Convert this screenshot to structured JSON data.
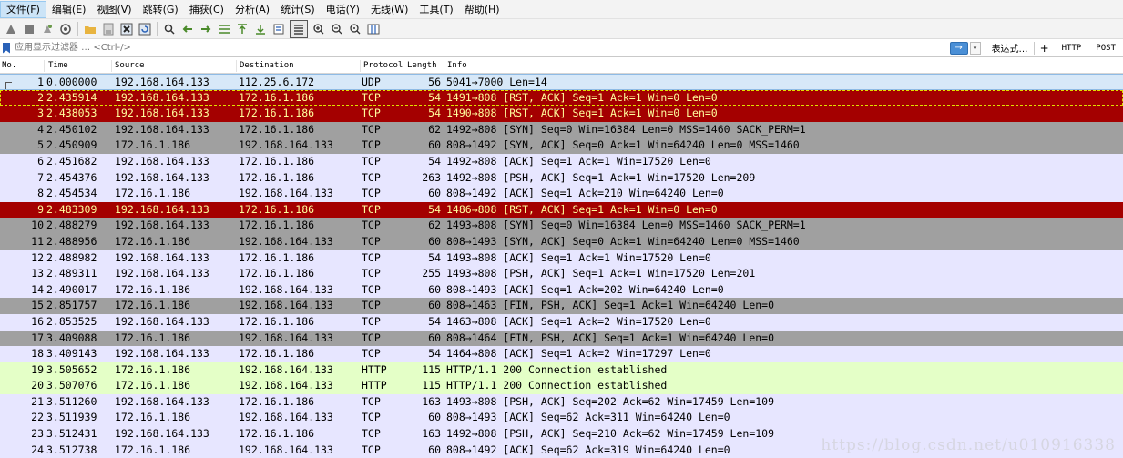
{
  "menu": {
    "items": [
      "文件(F)",
      "编辑(E)",
      "视图(V)",
      "跳转(G)",
      "捕获(C)",
      "分析(A)",
      "统计(S)",
      "电话(Y)",
      "无线(W)",
      "工具(T)",
      "帮助(H)"
    ]
  },
  "filter": {
    "placeholder": "应用显示过滤器 … <Ctrl-/>",
    "apply_icon": "→",
    "dropdown_icon": "▾",
    "expression_label": "表达式…",
    "plus_label": "+",
    "quick_buttons": [
      "HTTP",
      "POST"
    ]
  },
  "columns": {
    "no": "No.",
    "time": "Time",
    "source": "Source",
    "destination": "Destination",
    "protocol": "Protocol",
    "length": "Length",
    "info": "Info"
  },
  "packets": [
    {
      "no": "1",
      "time": "0.000000",
      "source": "192.168.164.133",
      "destination": "112.25.6.172",
      "protocol": "UDP",
      "length": "56",
      "info": "5041→7000 Len=14",
      "style": "selected"
    },
    {
      "no": "2",
      "time": "2.435914",
      "source": "192.168.164.133",
      "destination": "172.16.1.186",
      "protocol": "TCP",
      "length": "54",
      "info": "1491→808 [RST, ACK] Seq=1 Ack=1 Win=0 Len=0",
      "style": "rst"
    },
    {
      "no": "3",
      "time": "2.438053",
      "source": "192.168.164.133",
      "destination": "172.16.1.186",
      "protocol": "TCP",
      "length": "54",
      "info": "1490→808 [RST, ACK] Seq=1 Ack=1 Win=0 Len=0",
      "style": "rst"
    },
    {
      "no": "4",
      "time": "2.450102",
      "source": "192.168.164.133",
      "destination": "172.16.1.186",
      "protocol": "TCP",
      "length": "62",
      "info": "1492→808 [SYN] Seq=0 Win=16384 Len=0 MSS=1460 SACK_PERM=1",
      "style": "syn"
    },
    {
      "no": "5",
      "time": "2.450909",
      "source": "172.16.1.186",
      "destination": "192.168.164.133",
      "protocol": "TCP",
      "length": "60",
      "info": "808→1492 [SYN, ACK] Seq=0 Ack=1 Win=64240 Len=0 MSS=1460",
      "style": "syn"
    },
    {
      "no": "6",
      "time": "2.451682",
      "source": "192.168.164.133",
      "destination": "172.16.1.186",
      "protocol": "TCP",
      "length": "54",
      "info": "1492→808 [ACK] Seq=1 Ack=1 Win=17520 Len=0",
      "style": "tcp"
    },
    {
      "no": "7",
      "time": "2.454376",
      "source": "192.168.164.133",
      "destination": "172.16.1.186",
      "protocol": "TCP",
      "length": "263",
      "info": "1492→808 [PSH, ACK] Seq=1 Ack=1 Win=17520 Len=209",
      "style": "tcp"
    },
    {
      "no": "8",
      "time": "2.454534",
      "source": "172.16.1.186",
      "destination": "192.168.164.133",
      "protocol": "TCP",
      "length": "60",
      "info": "808→1492 [ACK] Seq=1 Ack=210 Win=64240 Len=0",
      "style": "tcp"
    },
    {
      "no": "9",
      "time": "2.483309",
      "source": "192.168.164.133",
      "destination": "172.16.1.186",
      "protocol": "TCP",
      "length": "54",
      "info": "1486→808 [RST, ACK] Seq=1 Ack=1 Win=0 Len=0",
      "style": "rst"
    },
    {
      "no": "10",
      "time": "2.488279",
      "source": "192.168.164.133",
      "destination": "172.16.1.186",
      "protocol": "TCP",
      "length": "62",
      "info": "1493→808 [SYN] Seq=0 Win=16384 Len=0 MSS=1460 SACK_PERM=1",
      "style": "syn"
    },
    {
      "no": "11",
      "time": "2.488956",
      "source": "172.16.1.186",
      "destination": "192.168.164.133",
      "protocol": "TCP",
      "length": "60",
      "info": "808→1493 [SYN, ACK] Seq=0 Ack=1 Win=64240 Len=0 MSS=1460",
      "style": "syn"
    },
    {
      "no": "12",
      "time": "2.488982",
      "source": "192.168.164.133",
      "destination": "172.16.1.186",
      "protocol": "TCP",
      "length": "54",
      "info": "1493→808 [ACK] Seq=1 Ack=1 Win=17520 Len=0",
      "style": "tcp"
    },
    {
      "no": "13",
      "time": "2.489311",
      "source": "192.168.164.133",
      "destination": "172.16.1.186",
      "protocol": "TCP",
      "length": "255",
      "info": "1493→808 [PSH, ACK] Seq=1 Ack=1 Win=17520 Len=201",
      "style": "tcp"
    },
    {
      "no": "14",
      "time": "2.490017",
      "source": "172.16.1.186",
      "destination": "192.168.164.133",
      "protocol": "TCP",
      "length": "60",
      "info": "808→1493 [ACK] Seq=1 Ack=202 Win=64240 Len=0",
      "style": "tcp"
    },
    {
      "no": "15",
      "time": "2.851757",
      "source": "172.16.1.186",
      "destination": "192.168.164.133",
      "protocol": "TCP",
      "length": "60",
      "info": "808→1463 [FIN, PSH, ACK] Seq=1 Ack=1 Win=64240 Len=0",
      "style": "syn"
    },
    {
      "no": "16",
      "time": "2.853525",
      "source": "192.168.164.133",
      "destination": "172.16.1.186",
      "protocol": "TCP",
      "length": "54",
      "info": "1463→808 [ACK] Seq=1 Ack=2 Win=17520 Len=0",
      "style": "tcp"
    },
    {
      "no": "17",
      "time": "3.409088",
      "source": "172.16.1.186",
      "destination": "192.168.164.133",
      "protocol": "TCP",
      "length": "60",
      "info": "808→1464 [FIN, PSH, ACK] Seq=1 Ack=1 Win=64240 Len=0",
      "style": "syn"
    },
    {
      "no": "18",
      "time": "3.409143",
      "source": "192.168.164.133",
      "destination": "172.16.1.186",
      "protocol": "TCP",
      "length": "54",
      "info": "1464→808 [ACK] Seq=1 Ack=2 Win=17297 Len=0",
      "style": "tcp"
    },
    {
      "no": "19",
      "time": "3.505652",
      "source": "172.16.1.186",
      "destination": "192.168.164.133",
      "protocol": "HTTP",
      "length": "115",
      "info": "HTTP/1.1 200 Connection established",
      "style": "http"
    },
    {
      "no": "20",
      "time": "3.507076",
      "source": "172.16.1.186",
      "destination": "192.168.164.133",
      "protocol": "HTTP",
      "length": "115",
      "info": "HTTP/1.1 200 Connection established",
      "style": "http"
    },
    {
      "no": "21",
      "time": "3.511260",
      "source": "192.168.164.133",
      "destination": "172.16.1.186",
      "protocol": "TCP",
      "length": "163",
      "info": "1493→808 [PSH, ACK] Seq=202 Ack=62 Win=17459 Len=109",
      "style": "tcp"
    },
    {
      "no": "22",
      "time": "3.511939",
      "source": "172.16.1.186",
      "destination": "192.168.164.133",
      "protocol": "TCP",
      "length": "60",
      "info": "808→1493 [ACK] Seq=62 Ack=311 Win=64240 Len=0",
      "style": "tcp"
    },
    {
      "no": "23",
      "time": "3.512431",
      "source": "192.168.164.133",
      "destination": "172.16.1.186",
      "protocol": "TCP",
      "length": "163",
      "info": "1492→808 [PSH, ACK] Seq=210 Ack=62 Win=17459 Len=109",
      "style": "tcp"
    },
    {
      "no": "24",
      "time": "3.512738",
      "source": "172.16.1.186",
      "destination": "192.168.164.133",
      "protocol": "TCP",
      "length": "60",
      "info": "808→1492 [ACK] Seq=62 Ack=319 Win=64240 Len=0",
      "style": "tcp"
    }
  ],
  "watermark": "https://blog.csdn.net/u010916338"
}
